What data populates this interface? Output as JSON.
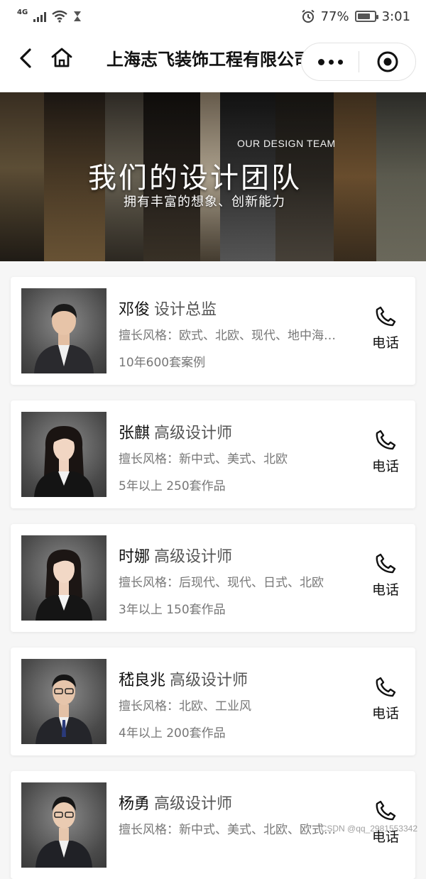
{
  "status_bar": {
    "network": "4G",
    "battery_percent": "77%",
    "battery_level": 0.77,
    "time": "3:01"
  },
  "nav": {
    "title": "上海志飞装饰工程有限公司"
  },
  "banner": {
    "subtitle_en": "OUR DESIGN TEAM",
    "title": "我们的设计团队",
    "tagline": "拥有丰富的想象、创新能力"
  },
  "designers": [
    {
      "name": "邓俊",
      "role": "设计总监",
      "styles": "擅长风格：欧式、北欧、现代、地中海…",
      "experience": "10年600套案例",
      "call_label": "电话",
      "gender": "male"
    },
    {
      "name": "张麒",
      "role": "高级设计师",
      "styles": "擅长风格：新中式、美式、北欧",
      "experience": "5年以上 250套作品",
      "call_label": "电话",
      "gender": "female"
    },
    {
      "name": "时娜",
      "role": "高级设计师",
      "styles": "擅长风格：后现代、现代、日式、北欧",
      "experience": "3年以上 150套作品",
      "call_label": "电话",
      "gender": "female"
    },
    {
      "name": "嵇良兆",
      "role": "高级设计师",
      "styles": "擅长风格：北欧、工业风",
      "experience": "4年以上 200套作品",
      "call_label": "电话",
      "gender": "male"
    },
    {
      "name": "杨勇",
      "role": "高级设计师",
      "styles": "擅长风格：新中式、美式、北欧、欧式…",
      "experience": "",
      "call_label": "电话",
      "gender": "male"
    }
  ],
  "watermark": "CSDN @qq_2981553342",
  "colors": {
    "background": "#f6f6f6",
    "card": "#ffffff",
    "text_primary": "#111111",
    "text_secondary": "#777777"
  },
  "icons": [
    "back-arrow-icon",
    "home-icon",
    "more-dots-icon",
    "close-mini-program-icon",
    "phone-icon",
    "wifi-icon",
    "alarm-icon",
    "battery-icon"
  ]
}
